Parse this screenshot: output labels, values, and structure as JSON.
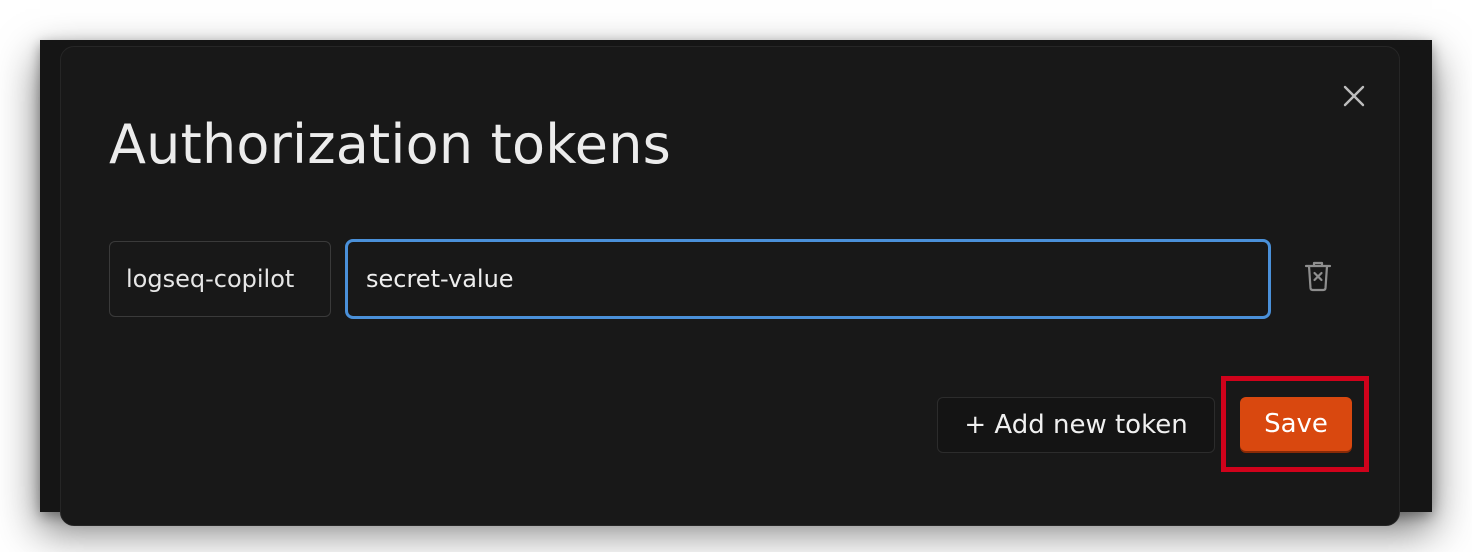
{
  "dialog": {
    "title": "Authorization tokens",
    "close_icon": "close-icon",
    "tokens": [
      {
        "name": "logseq-copilot",
        "value": "secret-value",
        "delete_icon": "trash-icon"
      }
    ],
    "add_button_label": "+ Add new token",
    "save_button_label": "Save"
  },
  "colors": {
    "background": "#181818",
    "title_text": "#ececec",
    "focus_border": "#4a90d9",
    "save_button": "#d9480f",
    "highlight_box": "#d0021b"
  }
}
